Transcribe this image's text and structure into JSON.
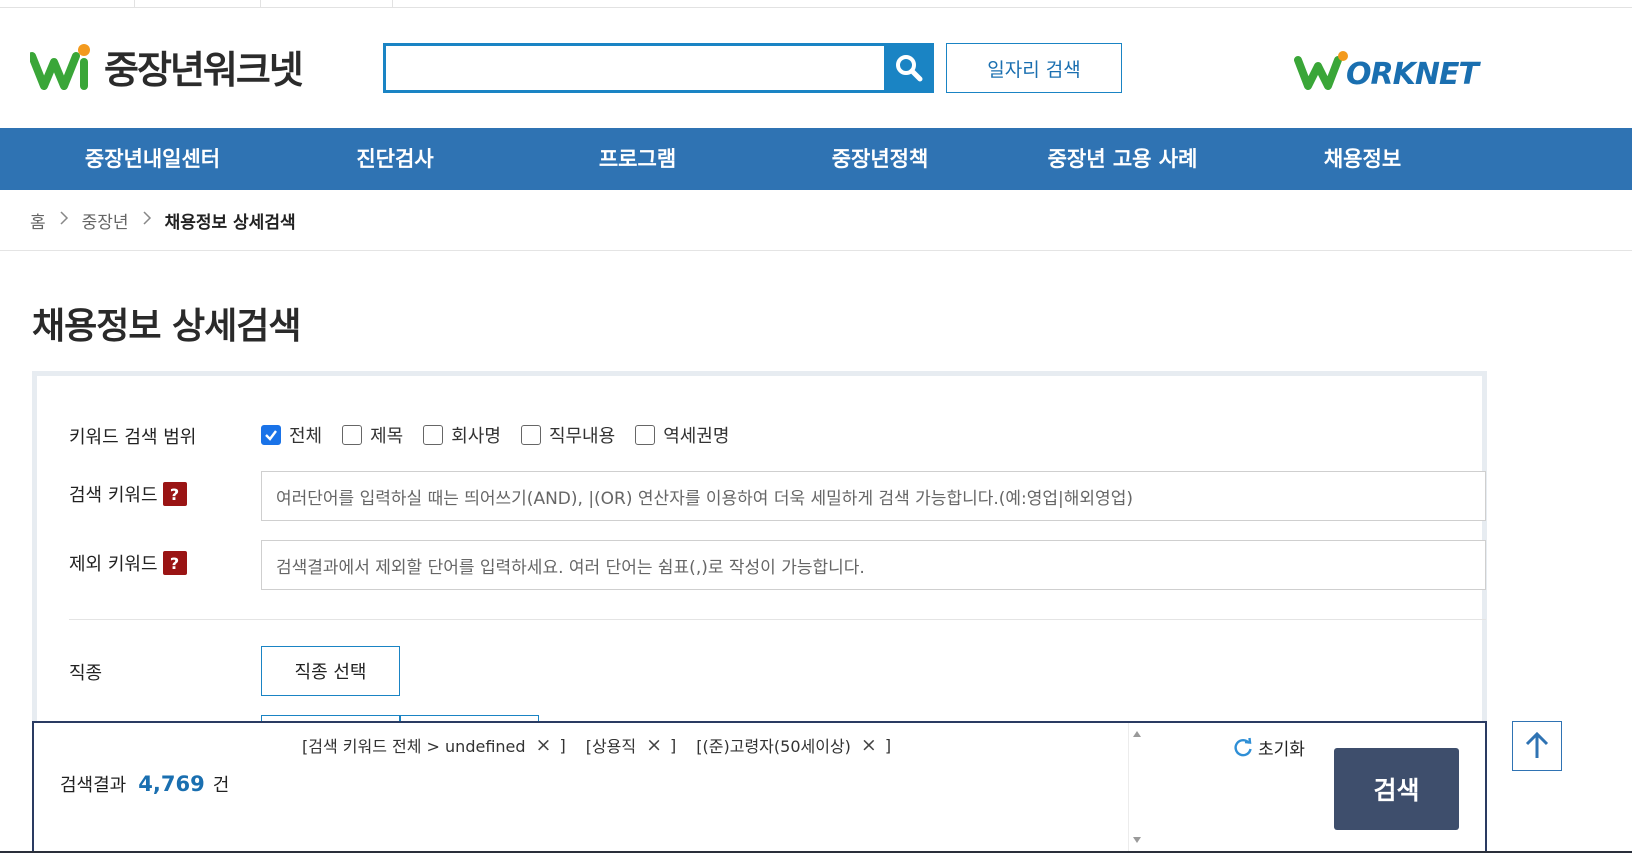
{
  "header": {
    "logo_text": "중장년워크넷",
    "search_input": {
      "value": "",
      "placeholder": ""
    },
    "job_search_label": "일자리 검색",
    "worknet_text": "ORKNET"
  },
  "nav": {
    "items": [
      {
        "label": "중장년내일센터"
      },
      {
        "label": "진단검사"
      },
      {
        "label": "프로그램"
      },
      {
        "label": "중장년정책"
      },
      {
        "label": "중장년 고용 사례"
      },
      {
        "label": "채용정보"
      }
    ]
  },
  "breadcrumb": {
    "home": "홈",
    "level1": "중장년",
    "current": "채용정보 상세검색"
  },
  "page": {
    "title": "채용정보 상세검색"
  },
  "form": {
    "scope_label": "키워드 검색 범위",
    "scope_options": [
      {
        "label": "전체",
        "checked": true
      },
      {
        "label": "제목",
        "checked": false
      },
      {
        "label": "회사명",
        "checked": false
      },
      {
        "label": "직무내용",
        "checked": false
      },
      {
        "label": "역세권명",
        "checked": false
      }
    ],
    "keyword_label": "검색 키워드",
    "keyword_placeholder": "여러단어를 입력하실 때는 띄어쓰기(AND), |(OR) 연산자를 이용하여 더욱 세밀하게 검색 가능합니다.(예:영업|해외영업)",
    "exclude_label": "제외 키워드",
    "exclude_placeholder": "검색결과에서 제외할 단어를 입력하세요. 여러 단어는 쉼표(,)로 작성이 가능합니다.",
    "help_glyph": "?",
    "job_type_label": "직종",
    "job_type_button": "직종 선택"
  },
  "bottom_bar": {
    "tags": [
      {
        "label": "[검색 키워드 전체 > undefined",
        "close": "×",
        "end": "]"
      },
      {
        "label": "[상용직",
        "close": "×",
        "end": "]"
      },
      {
        "label": "[(준)고령자(50세이상)",
        "close": "×",
        "end": "]"
      }
    ],
    "result_label": "검색결과",
    "result_count": "4,769",
    "result_unit": "건",
    "reset_label": "초기화",
    "search_label": "검색"
  },
  "colors": {
    "nav_blue": "#2f73b3",
    "search_blue": "#1a84c4",
    "help_red": "#9a1414",
    "search_btn_navy": "#3e4e6c",
    "count_blue": "#1a6fb0",
    "logo_green": "#3aa638",
    "logo_orange": "#f39a1e"
  },
  "icons": {
    "search": "magnifier-icon",
    "reset": "refresh-icon",
    "top": "arrow-up-icon",
    "breadcrumb_sep": "chevron-right-icon"
  }
}
